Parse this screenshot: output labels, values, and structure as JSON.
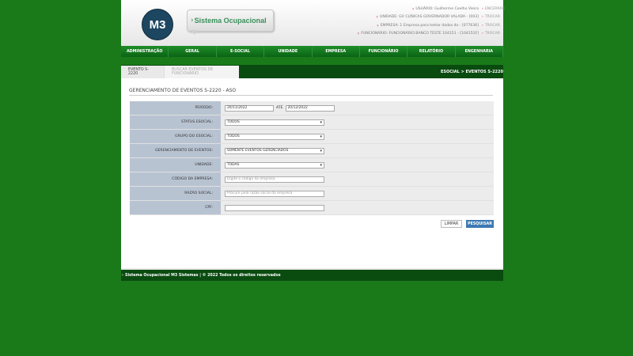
{
  "logo": {
    "initials": "M3",
    "product": "Sistema Ocupacional",
    "chevron": "›"
  },
  "userinfo": [
    {
      "label": "USUÁRIO: Guilherme Coelho Vieira",
      "action": "ENCERRAR"
    },
    {
      "label": "UNIDADE: GV CLÍNICAS GOVERNADOR VALADA - [003]",
      "action": "TROCAR"
    },
    {
      "label": "EMPRESA: 1 Empresa para testar dados do - [077636]",
      "action": "TROCAR"
    },
    {
      "label": "FUNCIONÁRIO: FUNCIONÁRIO BANCO TESTE 104151 - [104151F]",
      "action": "TROCAR"
    }
  ],
  "nav": [
    "ADMINISTRAÇÃO",
    "GERAL",
    "E-SOCIAL",
    "UNIDADE",
    "EMPRESA",
    "FUNCIONÁRIO",
    "RELATÓRIO",
    "ENGENHARIA"
  ],
  "tabs": {
    "active": "EVENTO S-2220",
    "inactive": "BUSCAR EVENTOS DE FUNCIONÁRIO"
  },
  "breadcrumb": "ESOCIAL > EVENTOS S-2220",
  "section_title": "GERENCIAMENTO DE EVENTOS S-2220 - ASO",
  "form": {
    "periodo": {
      "label": "PERÍODO:",
      "from": "20/11/2022",
      "ate": "ATÉ",
      "to": "20/12/2022"
    },
    "status": {
      "label": "STATUS ESOCIAL:",
      "value": "TODOS"
    },
    "grupo": {
      "label": "GRUPO DO ESOCIAL:",
      "value": "TODOS"
    },
    "gerenciamento": {
      "label": "GERENCIAMENTO DE EVENTOS:",
      "value": "SOMENTE EVENTOS GERENCIADOS"
    },
    "unidade": {
      "label": "UNIDADE:",
      "value": "TODAS"
    },
    "codigo": {
      "label": "CÓDIGO DA EMPRESA:",
      "placeholder": "Digite o código da empresa"
    },
    "razao": {
      "label": "RAZÃO SOCIAL:",
      "placeholder": "Procure pela razão social da empresa"
    },
    "cpf": {
      "label": "CPF:",
      "value": ""
    }
  },
  "buttons": {
    "limpar": "LIMPAR",
    "pesquisar": "PESQUISAR"
  },
  "footer": "Sistema Ocupacional M3 Sistemas | © 2022 Todos os direitos reservados",
  "colors": {
    "background": "#1a7a1a",
    "nav": "#0d6b17",
    "primary_button": "#3c79b3",
    "label_bg": "#b8c3d2"
  },
  "icons": {
    "caret": "▾",
    "arrow": "›"
  }
}
